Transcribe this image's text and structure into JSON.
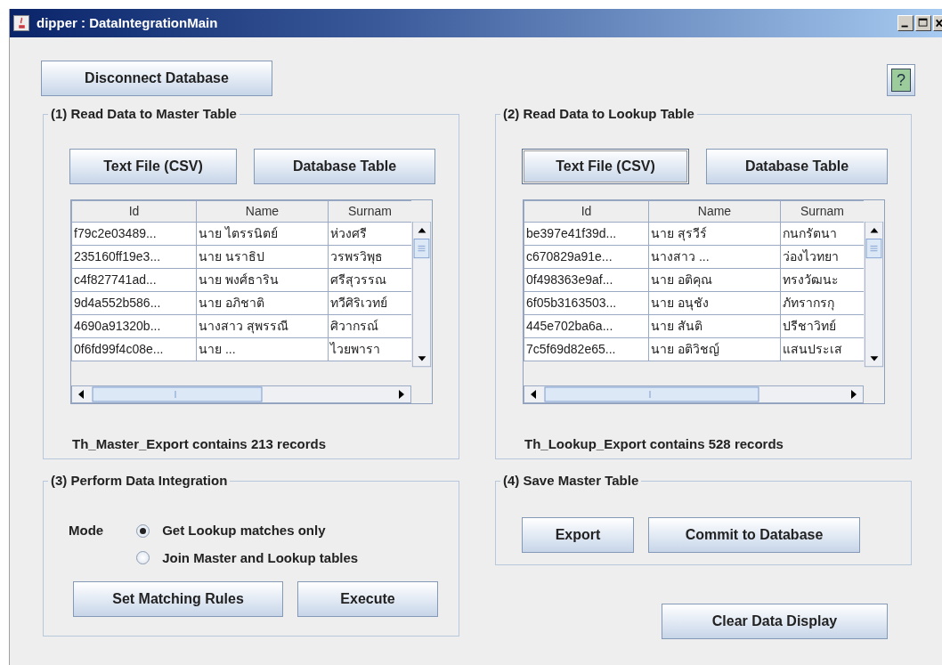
{
  "window": {
    "title": "dipper : DataIntegrationMain"
  },
  "toolbar": {
    "disconnect_button": "Disconnect Database",
    "help_button": "?"
  },
  "master_panel": {
    "title": "(1)  Read Data to Master Table",
    "buttons": [
      {
        "label": "Text File (CSV)",
        "focused": false
      },
      {
        "label": "Database Table",
        "focused": false
      }
    ],
    "table": {
      "columns": [
        "Id",
        "Name",
        "Surnam"
      ],
      "rows": [
        [
          "f79c2e03489...",
          "นาย ไตรรนิตย์",
          "ห่วงศรี"
        ],
        [
          "235160ff19e3...",
          "นาย นราธิป",
          "วรพรวิพุธ"
        ],
        [
          "c4f827741ad...",
          "นาย พงศ์ธาริน",
          "ศรีสุวรรณ"
        ],
        [
          "9d4a552b586...",
          "นาย อภิชาติ",
          "ทวีศิริเวทย์"
        ],
        [
          "4690a91320b...",
          "นางสาว สุพรรณี",
          "ศิวากรณ์"
        ],
        [
          "0f6fd99f4c08e...",
          "นาย ...",
          "ไวยพารา"
        ]
      ]
    },
    "status": "Th_Master_Export contains 213 records"
  },
  "lookup_panel": {
    "title": "(2)  Read Data to Lookup Table",
    "buttons": [
      {
        "label": "Text File (CSV)",
        "focused": true
      },
      {
        "label": "Database Table",
        "focused": false
      }
    ],
    "table": {
      "columns": [
        "Id",
        "Name",
        "Surnam"
      ],
      "rows": [
        [
          "be397e41f39d...",
          "นาย สุรวีร์",
          "กนกรัตนา"
        ],
        [
          "c670829a91e...",
          "นางสาว ...",
          "ว่องไวทยา"
        ],
        [
          "0f498363e9af...",
          "นาย อติคุณ",
          "ทรงวัฒนะ"
        ],
        [
          "6f05b3163503...",
          "นาย อนุชัง",
          "ภัทรากรกุ"
        ],
        [
          "445e702ba6a...",
          "นาย สันติ",
          "ปรีชาวิทย์"
        ],
        [
          "7c5f69d82e65...",
          "นาย อติวิชญ์",
          "แสนประเส"
        ]
      ]
    },
    "status": "Th_Lookup_Export contains 528 records"
  },
  "integration_panel": {
    "title": "(3)  Perform Data Integration",
    "mode_label": "Mode",
    "options": [
      {
        "label": "Get Lookup matches only",
        "selected": true
      },
      {
        "label": "Join Master and Lookup tables",
        "selected": false
      }
    ],
    "buttons": [
      "Set Matching Rules",
      "Execute"
    ]
  },
  "save_panel": {
    "title": "(4)  Save Master Table",
    "buttons": [
      "Export",
      "Commit to Database"
    ]
  },
  "clear_button": "Clear Data Display"
}
